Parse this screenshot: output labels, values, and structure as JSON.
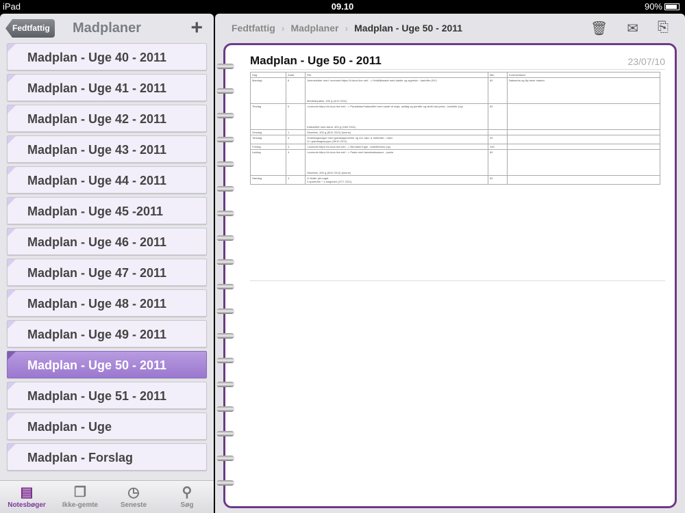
{
  "status": {
    "device": "iPad",
    "time": "09.10",
    "battery": "90%"
  },
  "sidebar": {
    "back_label": "Fedtfattig",
    "title": "Madplaner",
    "add_icon": "plus-icon",
    "items": [
      {
        "label": "Madplan - Uge 40 - 2011"
      },
      {
        "label": "Madplan - Uge 41 - 2011"
      },
      {
        "label": "Madplan - Uge 42 - 2011"
      },
      {
        "label": "Madplan - Uge 43 - 2011"
      },
      {
        "label": "Madplan - Uge 44 - 2011"
      },
      {
        "label": "Madplan - Uge 45 -2011"
      },
      {
        "label": "Madplan - Uge 46 - 2011"
      },
      {
        "label": "Madplan - Uge 47 - 2011"
      },
      {
        "label": "Madplan - Uge 48 - 2011"
      },
      {
        "label": "Madplan - Uge 49 - 2011"
      },
      {
        "label": "Madplan - Uge 50 - 2011",
        "selected": true
      },
      {
        "label": "Madplan - Uge 51 - 2011"
      },
      {
        "label": "Madplan - Uge"
      },
      {
        "label": "Madplan - Forslag"
      }
    ],
    "tabs": [
      {
        "label": "Notesbøger",
        "icon": "notebook-icon",
        "active": true
      },
      {
        "label": "Ikke-gemte",
        "icon": "documents-icon"
      },
      {
        "label": "Seneste",
        "icon": "clock-icon"
      },
      {
        "label": "Søg",
        "icon": "search-icon"
      }
    ]
  },
  "header": {
    "breadcrumbs": [
      "Fedtfattig",
      "Madplaner",
      "Madplan - Uge 50 - 2011"
    ],
    "tools": [
      "trash-icon",
      "mail-icon",
      "new-page-icon"
    ]
  },
  "page": {
    "title": "Madplan - Uge 50 - 2011",
    "date": "23/07/10",
    "table": {
      "headers": [
        "Dag",
        "Antal",
        "Ret",
        "Min",
        "Kommentarer"
      ],
      "rows": [
        [
          "Mandag",
          "6",
          "Julemedister med <onenote:https://d.docs.live.net/...> Hvidkålssalat med dadler og appelsin - kartofler (NY)\n\n\n\n\n\nMedisterpølse, 400 g (4/11 2011)",
          "60",
          "Natascha og flip laver maden"
        ],
        [
          "Tirsdag",
          "6",
          "<onenote:https://d.docs.live.net/...> Paradisbøf kalkunfilet med sauté af majs, rødløg og persille og dertil rød pesto - kartofler (ny)\n\n\n\n\n\nKalkunfilet med skind, 400 g (16/9 2011)",
          "60",
          ""
        ],
        [
          "Onsdag",
          "1",
          "Oksefars, 400 g (8/10 2011) (kunne)",
          "",
          ""
        ],
        [
          "Torsdag",
          "4",
          "Grøntsagssuppe med grøntsagsmelner og evt. kød- & melboller - brød\n½ l grøntsagssuppe (28/10 2011)",
          "40",
          ""
        ],
        [
          "Fredag",
          "4",
          "<onenote:https://d.docs.live.net/...> Bernaise fugle - kartoffelmos (ny)",
          "100",
          ""
        ],
        [
          "Lørdag",
          "4",
          "<onenote:https://d.docs.live.net/...> Pasta med tamatsakssauce - pasta\n\n\n\n\n\nOksefars, 400 g (8/10 2011) (kunne)",
          "60",
          ""
        ],
        [
          "Søndag",
          "4",
          "Vi finder på noget\n3 spareribs + 4 stegeben (27/7 2011)",
          "60",
          ""
        ]
      ]
    }
  }
}
